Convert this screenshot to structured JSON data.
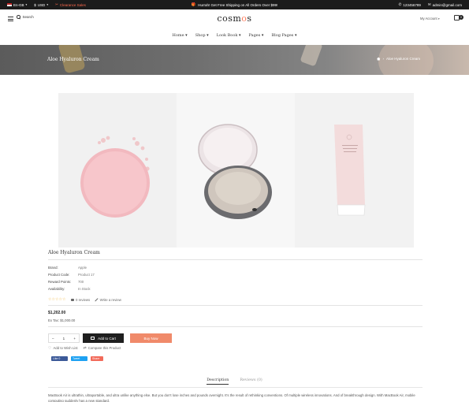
{
  "topbar": {
    "language": "En-GB",
    "currency": "USD",
    "clearance": "Clearance Sales",
    "promo": "Hurrah! Get Free Shipping on All Orders Over $99!",
    "phone": "123456789",
    "email": "admin@gmail.com"
  },
  "header": {
    "search_label": "Search",
    "logo_prefix": "cosm",
    "logo_accent": "o",
    "logo_suffix": "s",
    "account_label": "My Account",
    "cart_count": "0"
  },
  "nav": {
    "items": [
      "Home",
      "Shop",
      "Look Book",
      "Pages",
      "Blog Pages"
    ]
  },
  "banner": {
    "title": "Aloe Hyaluron Cream",
    "breadcrumb_current": "Aloe Hyaluron Cream"
  },
  "product": {
    "title": "Aloe Hyaluron Cream",
    "specs": [
      {
        "label": "Brand:",
        "value": "Apple"
      },
      {
        "label": "Product Code:",
        "value": "Product 17"
      },
      {
        "label": "Reward Points:",
        "value": "700"
      },
      {
        "label": "Availability:",
        "value": "In Stock"
      }
    ],
    "rating_stars": 0,
    "reviews_label": "0 reviews",
    "write_review_label": "Write a review",
    "price": "$1,202.00",
    "ex_tax": "Ex Tax: $1,000.00",
    "quantity": "1",
    "add_to_cart_label": "Add to Cart",
    "buy_now_label": "Buy Now",
    "wishlist_label": "Add to Wish List",
    "compare_label": "Compare this Product"
  },
  "social": {
    "facebook": "Like 0",
    "twitter": "Tweet",
    "share": "Share"
  },
  "tabs": [
    "Description",
    "Reviews (0)"
  ],
  "description": "MacBook Air is ultrathin, ultraportable, and ultra unlike anything else. But you don't lose inches and pounds overnight. It's the result of rethinking conventions. Of multiple wireless innovations. And of breakthrough design. With MacBook Air, mobile computing suddenly has a new standard.",
  "colors": {
    "accent": "#f08a6a",
    "dark": "#1f1f1f",
    "star": "#f1b436",
    "facebook": "#3b5998",
    "twitter": "#1da1f2"
  }
}
